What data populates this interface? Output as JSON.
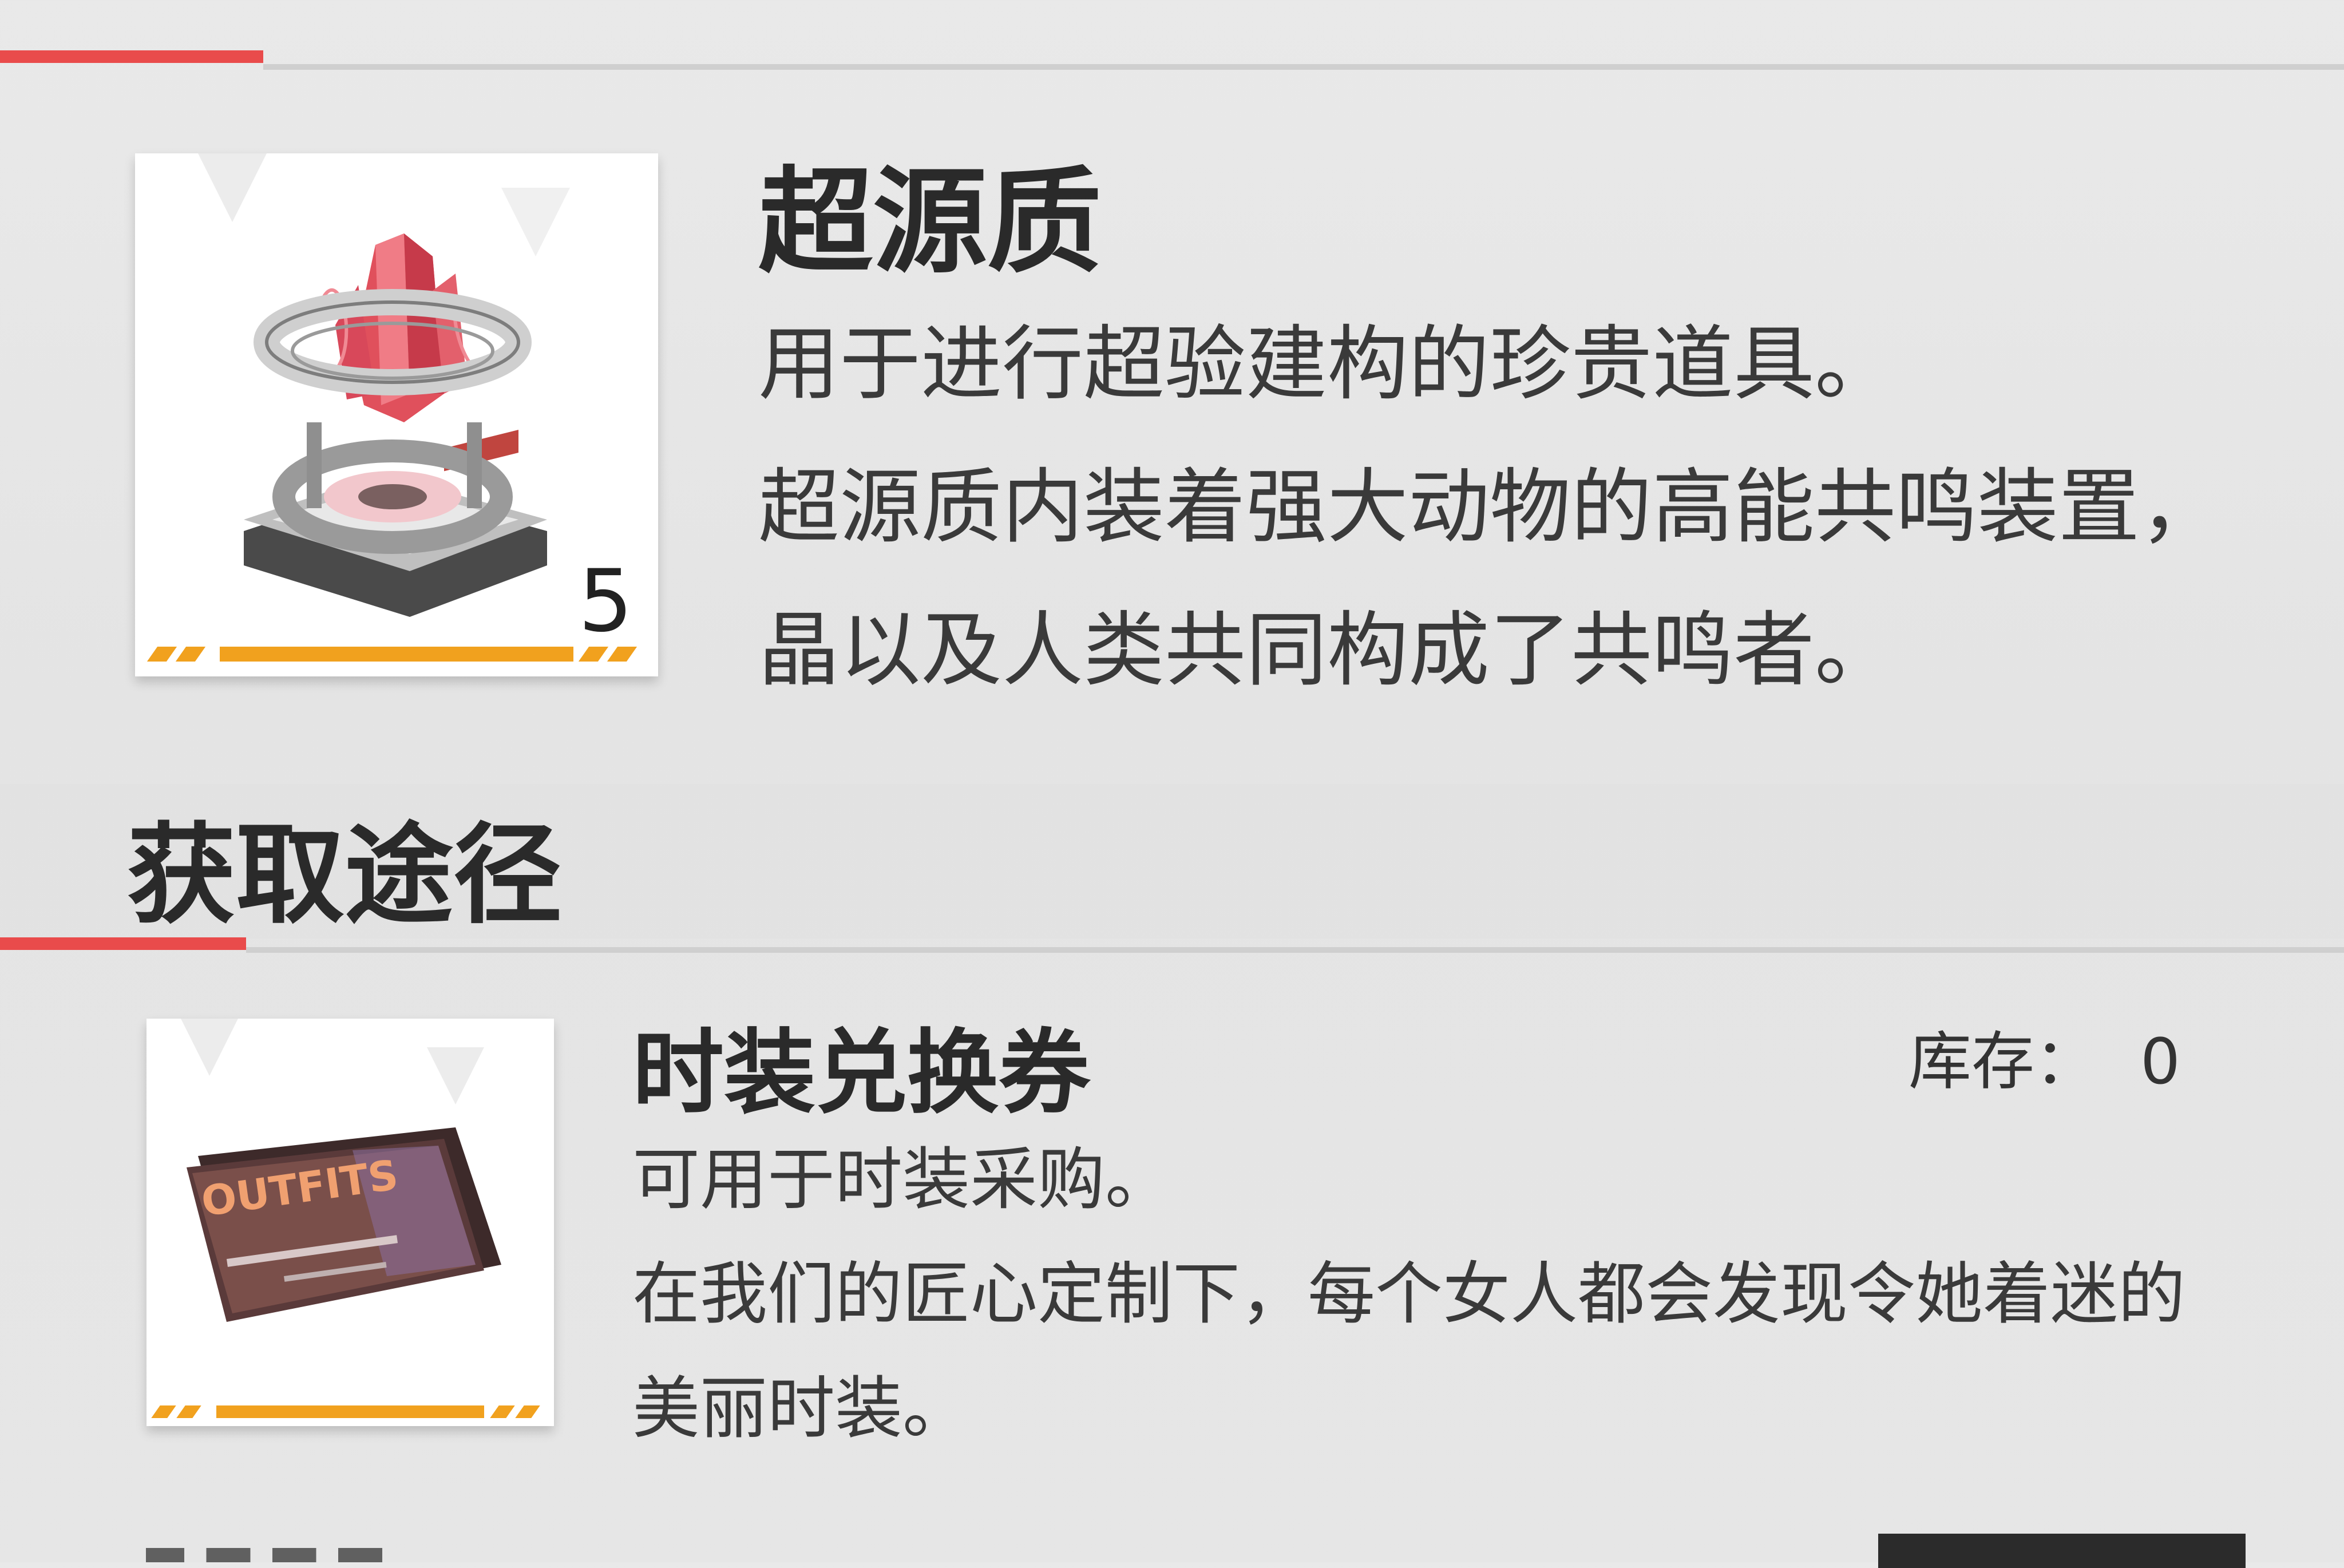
{
  "item": {
    "name": "超源质",
    "quantity": "5",
    "description_lines": [
      "用于进行超验建构的珍贵道具。",
      "超源质内装着强大动物的高能共鸣装置，",
      "晶以及人类共同构成了共鸣者。"
    ],
    "icon": "resonance-crystal-device-icon"
  },
  "acquisition": {
    "heading": "获取途径",
    "entries": [
      {
        "name": "时装兑换券",
        "stock_label": "库存：",
        "stock_value": "0",
        "icon": "outfits-voucher-icon",
        "icon_text": "OUTFITS",
        "description_lines": [
          "可用于时装采购。",
          "在我们的匠心定制下，每个女人都会发现令她着迷的",
          "美丽时装。"
        ]
      }
    ]
  },
  "colors": {
    "accent_red": "#e94b4b",
    "rarity_orange": "#f1a11e",
    "background": "#e6e6e6"
  }
}
